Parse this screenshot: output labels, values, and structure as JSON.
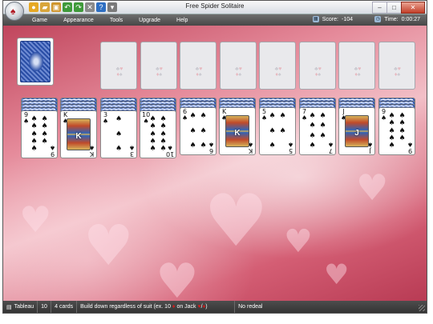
{
  "window": {
    "title": "Free Spider Solitaire",
    "buttons": {
      "minimize": "–",
      "maximize": "□",
      "close": "✕"
    }
  },
  "quick_access": [
    {
      "icon": "orb-icon",
      "glyph": "♠",
      "color": "#b01822"
    },
    {
      "icon": "new-game-icon",
      "glyph": "●",
      "color": "#e6a823"
    },
    {
      "icon": "open-icon",
      "glyph": "▰",
      "color": "#d8a53a"
    },
    {
      "icon": "save-icon",
      "glyph": "▣",
      "color": "#d0962e"
    },
    {
      "icon": "undo-icon",
      "glyph": "↶",
      "color": "#3f9a3a"
    },
    {
      "icon": "redo-icon",
      "glyph": "↷",
      "color": "#3f9a3a"
    },
    {
      "icon": "hint-icon",
      "glyph": "✕",
      "color": "#8a8a8a"
    },
    {
      "icon": "help-icon",
      "glyph": "?",
      "color": "#2e6fc2"
    },
    {
      "icon": "customize-icon",
      "glyph": "▾",
      "color": "#7a7a7a"
    }
  ],
  "menu": [
    "Game",
    "Appearance",
    "Tools",
    "Upgrade",
    "Help"
  ],
  "score": {
    "label": "Score:",
    "value": "-104"
  },
  "time": {
    "label": "Time:",
    "value": "0:00:27"
  },
  "foundations": [
    {
      "suits": [
        "♣",
        "♥",
        "♦",
        "♠"
      ]
    },
    {
      "suits": [
        "♣",
        "♥",
        "♦",
        "♠"
      ]
    },
    {
      "suits": [
        "♣",
        "♥",
        "♦",
        "♠"
      ]
    },
    {
      "suits": [
        "♣",
        "♥",
        "♦",
        "♠"
      ]
    },
    {
      "suits": [
        "♣",
        "♥",
        "♦",
        "♠"
      ]
    },
    {
      "suits": [
        "♣",
        "♥",
        "♦",
        "♠"
      ]
    },
    {
      "suits": [
        "♣",
        "♥",
        "♦",
        "♠"
      ]
    },
    {
      "suits": [
        "♣",
        "♥",
        "♦",
        "♠"
      ]
    }
  ],
  "tableau": [
    {
      "rank": "9",
      "suit": "♠",
      "face_down": 4,
      "kind": "pips"
    },
    {
      "rank": "K",
      "suit": "♠",
      "face_down": 4,
      "kind": "court"
    },
    {
      "rank": "3",
      "suit": "♠",
      "face_down": 4,
      "kind": "pips"
    },
    {
      "rank": "10",
      "suit": "♠",
      "face_down": 4,
      "kind": "pips"
    },
    {
      "rank": "6",
      "suit": "♠",
      "face_down": 3,
      "kind": "pips"
    },
    {
      "rank": "K",
      "suit": "♠",
      "face_down": 3,
      "kind": "court"
    },
    {
      "rank": "5",
      "suit": "♠",
      "face_down": 3,
      "kind": "pips"
    },
    {
      "rank": "7",
      "suit": "♠",
      "face_down": 3,
      "kind": "pips"
    },
    {
      "rank": "J",
      "suit": "♠",
      "face_down": 3,
      "kind": "court"
    },
    {
      "rank": "9",
      "suit": "♠",
      "face_down": 3,
      "kind": "pips"
    }
  ],
  "statusbar": {
    "section": "Tableau",
    "count": "10",
    "cards": "4 cards",
    "rule_prefix": "Build down regardless of suit (ex. 10",
    "rule_mid": "on Jack",
    "rule_suffix": ")",
    "redeal": "No redeal"
  }
}
